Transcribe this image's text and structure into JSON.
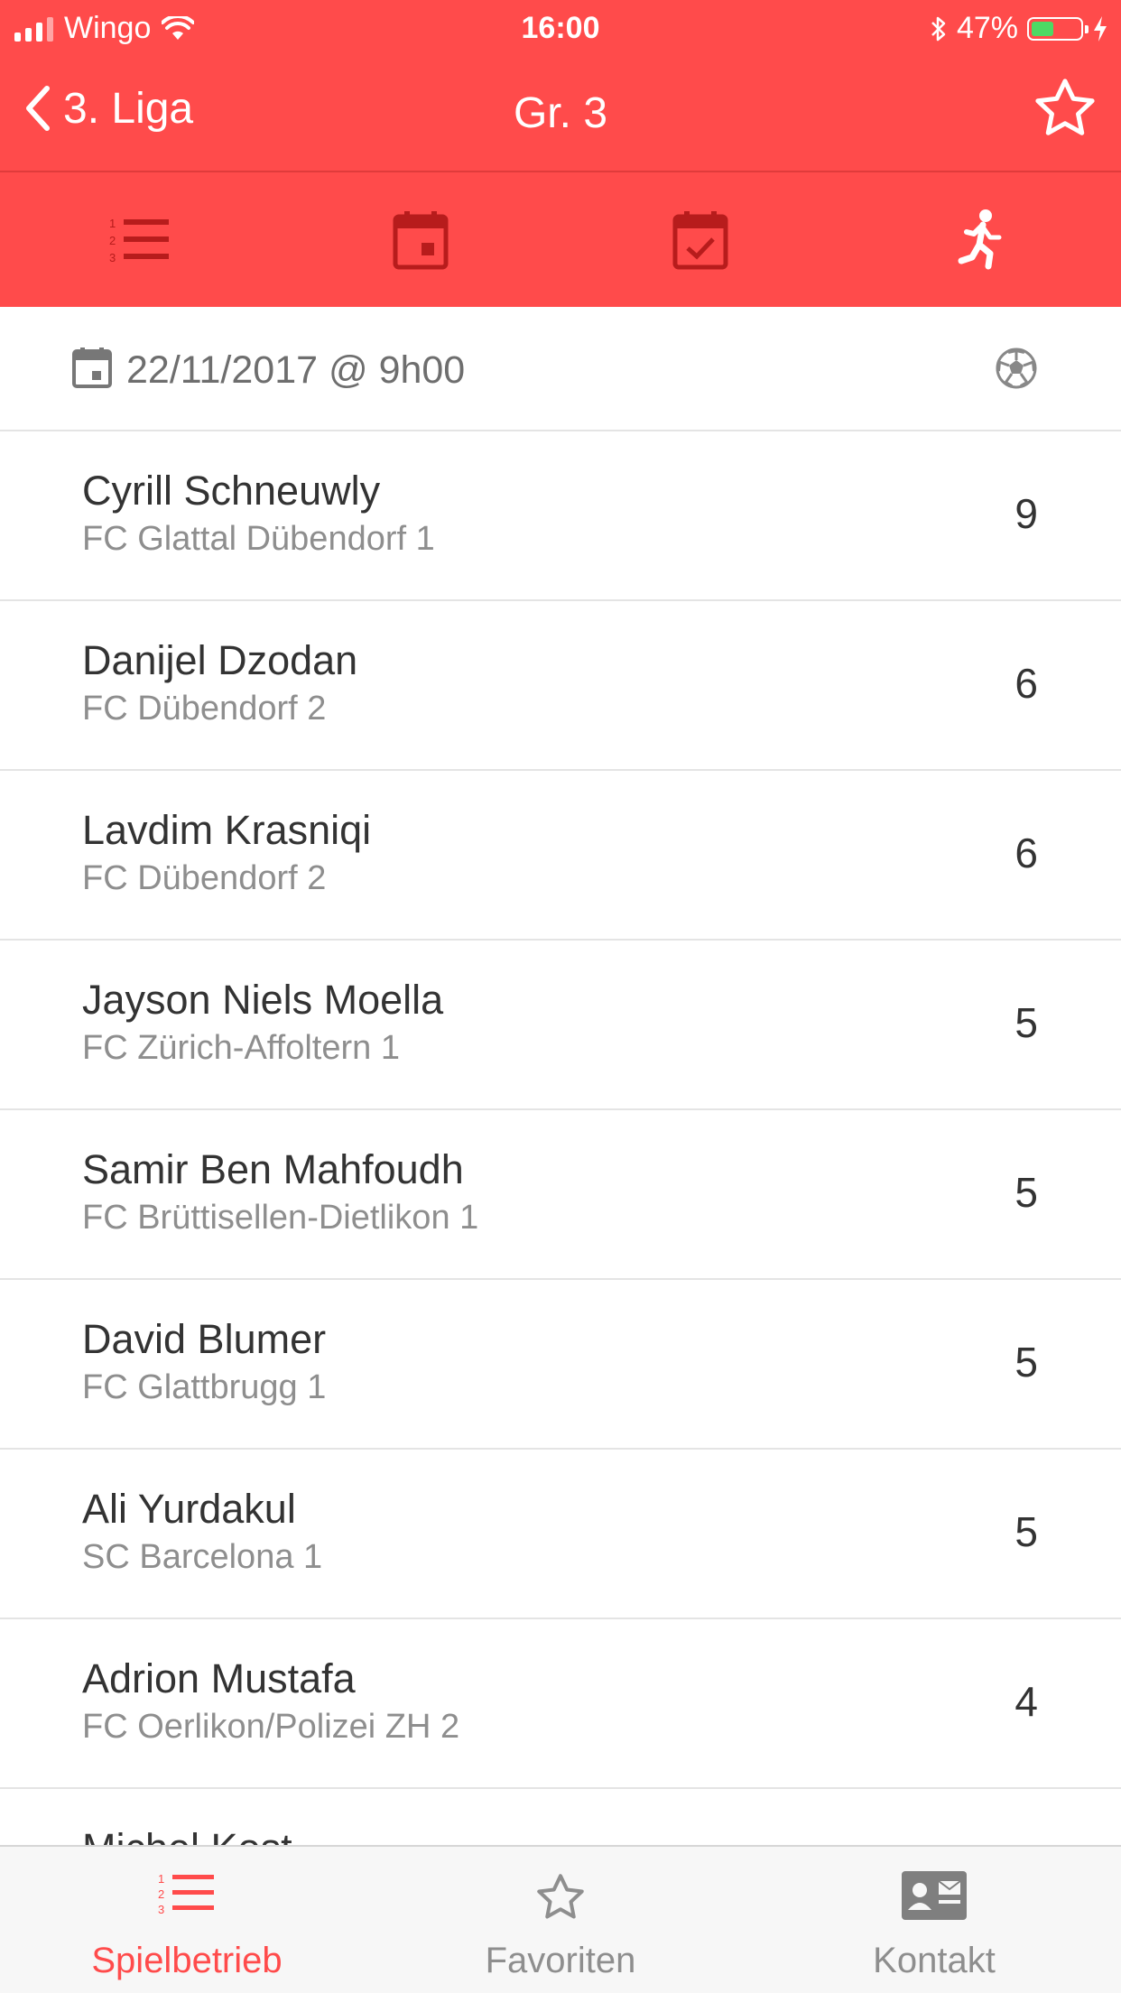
{
  "status_bar": {
    "carrier": "Wingo",
    "time": "16:00",
    "battery_percent": "47%",
    "battery_level": 0.47
  },
  "nav": {
    "back_label": "3. Liga",
    "title": "Gr. 3"
  },
  "colors": {
    "header_red": "#FF4B4B",
    "icon_dark_red": "#B71C1C",
    "active_tab": "#FF4B4B",
    "battery_green": "#4CD964"
  },
  "top_tabs": [
    {
      "icon": "ranking-list-icon",
      "active": false
    },
    {
      "icon": "calendar-icon",
      "active": false
    },
    {
      "icon": "calendar-check-icon",
      "active": false
    },
    {
      "icon": "runner-icon",
      "active": true
    }
  ],
  "section": {
    "date_label": "22/11/2017 @ 9h00",
    "icon": "soccer-ball-icon"
  },
  "scorers": [
    {
      "name": "Cyrill Schneuwly",
      "team": "FC Glattal Dübendorf 1",
      "goals": "9"
    },
    {
      "name": "Danijel Dzodan",
      "team": "FC Dübendorf 2",
      "goals": "6"
    },
    {
      "name": "Lavdim Krasniqi",
      "team": "FC Dübendorf 2",
      "goals": "6"
    },
    {
      "name": "Jayson Niels Moella",
      "team": "FC Zürich-Affoltern 1",
      "goals": "5"
    },
    {
      "name": "Samir Ben Mahfoudh",
      "team": "FC Brüttisellen-Dietlikon 1",
      "goals": "5"
    },
    {
      "name": "David Blumer",
      "team": "FC Glattbrugg 1",
      "goals": "5"
    },
    {
      "name": "Ali Yurdakul",
      "team": "SC Barcelona 1",
      "goals": "5"
    },
    {
      "name": "Adrion Mustafa",
      "team": "FC Oerlikon/Polizei ZH 2",
      "goals": "4"
    },
    {
      "name": "Michel Kost",
      "team": "",
      "goals": ""
    }
  ],
  "tab_bar": [
    {
      "label": "Spielbetrieb",
      "icon": "list-icon",
      "active": true
    },
    {
      "label": "Favoriten",
      "icon": "star-icon",
      "active": false
    },
    {
      "label": "Kontakt",
      "icon": "contact-card-icon",
      "active": false
    }
  ]
}
